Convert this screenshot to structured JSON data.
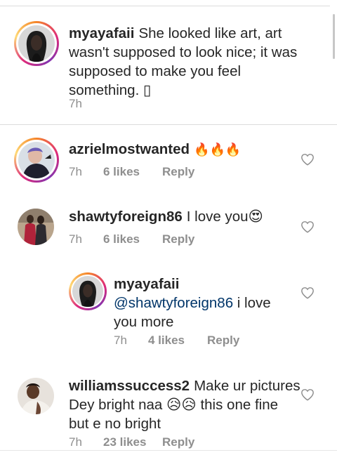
{
  "caption": {
    "username": "myayafaii",
    "text": "She looked like art, art wasn't supposed to look nice; it was supposed to make you feel something. ▯",
    "time": "7h"
  },
  "comments": [
    {
      "username": "azrielmostwanted",
      "text": "🔥🔥🔥",
      "time": "7h",
      "likes": "6 likes",
      "reply": "Reply"
    },
    {
      "username": "shawtyforeign86",
      "text": "I love you😍",
      "time": "7h",
      "likes": "6 likes",
      "reply": "Reply"
    },
    {
      "username": "myayafaii",
      "mention": "@shawtyforeign86",
      "text": " i love you more",
      "time": "7h",
      "likes": "4 likes",
      "reply": "Reply"
    },
    {
      "username": "williamssuccess2",
      "text": "Make ur pictures Dey bright naa 😥😥 this one fine but e no bright",
      "time": "7h",
      "likes": "23 likes",
      "reply": "Reply"
    }
  ],
  "icons": {
    "like": "heart-outline-icon"
  },
  "colors": {
    "mention": "#003569",
    "meta": "#8e8e8e",
    "divider": "#dbdbdb"
  }
}
